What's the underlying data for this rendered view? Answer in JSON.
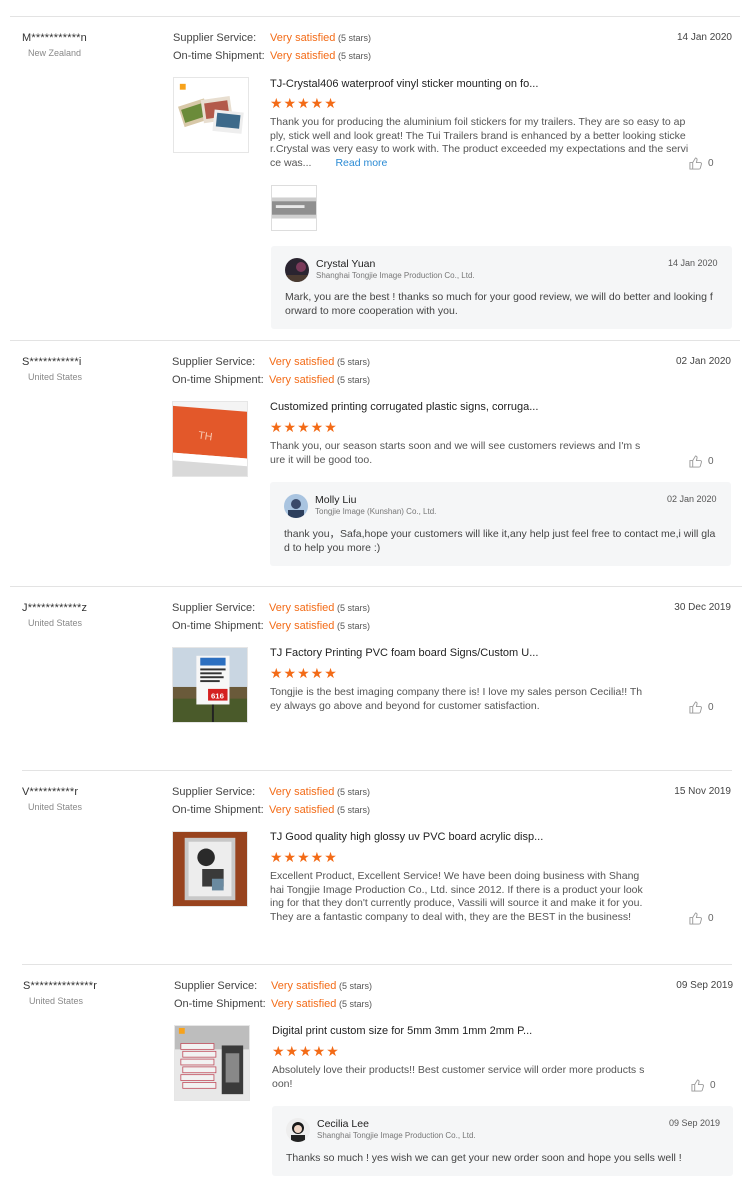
{
  "accent_color": "#f36b17",
  "link_color": "#2a8ad4",
  "labels": {
    "supplier_service": "Supplier Service:",
    "ontime_shipment": "On-time Shipment:",
    "read_more": "Read more",
    "stars_icon": "★★★★★"
  },
  "reviews": [
    {
      "buyer": "M***********n",
      "country": "New Zealand",
      "supplier_rating": "Very satisfied",
      "supplier_stars": "(5 stars)",
      "shipment_rating": "Very satisfied",
      "shipment_stars": "(5 stars)",
      "date": "14 Jan 2020",
      "product_title": "TJ-Crystal406 waterproof vinyl sticker mounting on fo...",
      "rating": 5,
      "content": "Thank you for producing the aluminium foil stickers for my trailers.  They are so easy to apply, stick well and look great!  The Tui Trailers brand is enhanced by a better looking sticker.Crystal was very easy to work with. The product exceeded my expectations and the service was...",
      "likes": "0",
      "reply": {
        "name": "Crystal Yuan",
        "company": "Shanghai Tongjie Image Production Co., Ltd.",
        "date": "14 Jan 2020",
        "text": "Mark, you are the best ! thanks so much for your good review, we will do better and looking forward to more cooperation with you."
      }
    },
    {
      "buyer": "S***********i",
      "country": "United States",
      "supplier_rating": "Very satisfied",
      "supplier_stars": "(5 stars)",
      "shipment_rating": "Very satisfied",
      "shipment_stars": "(5 stars)",
      "date": "02 Jan 2020",
      "product_title": "Customized printing corrugated plastic signs, corruga...",
      "rating": 5,
      "content": "Thank you, our season starts soon and we will see customers reviews and I'm sure it will be good too.",
      "likes": "0",
      "reply": {
        "name": "Molly Liu",
        "company": "Tongjie Image (Kunshan) Co., Ltd.",
        "date": "02 Jan 2020",
        "text": "thank you，Safa,hope your customers will like it,any help just feel free to contact me,i will glad to help you more :)"
      }
    },
    {
      "buyer": "J************z",
      "country": "United States",
      "supplier_rating": "Very satisfied",
      "supplier_stars": "(5 stars)",
      "shipment_rating": "Very satisfied",
      "shipment_stars": "(5 stars)",
      "date": "30 Dec 2019",
      "product_title": "TJ Factory Printing PVC foam board Signs/Custom U...",
      "rating": 5,
      "content": "Tongjie is the best imaging company there is! I love my sales person Cecilia!! They always go above and beyond for customer satisfaction.",
      "likes": "0",
      "thumb_text": "616"
    },
    {
      "buyer": "V**********r",
      "country": "United States",
      "supplier_rating": "Very satisfied",
      "supplier_stars": "(5 stars)",
      "shipment_rating": "Very satisfied",
      "shipment_stars": "(5 stars)",
      "date": "15 Nov 2019",
      "product_title": "TJ Good quality high glossy uv PVC board acrylic disp...",
      "rating": 5,
      "content": "Excellent Product, Excellent Service!  We have been doing business with Shanghai Tongjie Image Production Co., Ltd. since 2012.  If there is a product your looking for that they don't currently produce, Vassili will source it and make it for you.  They are a fantastic company to deal with, they are the BEST in the business!",
      "likes": "0"
    },
    {
      "buyer": "S**************r",
      "country": "United States",
      "supplier_rating": "Very satisfied",
      "supplier_stars": "(5 stars)",
      "shipment_rating": "Very satisfied",
      "shipment_stars": "(5 stars)",
      "date": "09 Sep 2019",
      "product_title": "Digital print custom size for 5mm 3mm 1mm 2mm P...",
      "rating": 5,
      "content": "Absolutely love their products!! Best customer service will order more products soon!",
      "likes": "0",
      "reply": {
        "name": "Cecilia Lee",
        "company": "Shanghai Tongjie Image Production Co., Ltd.",
        "date": "09 Sep 2019",
        "text": "Thanks so much ! yes wish we can get your new order soon and hope you sells well !"
      }
    }
  ]
}
